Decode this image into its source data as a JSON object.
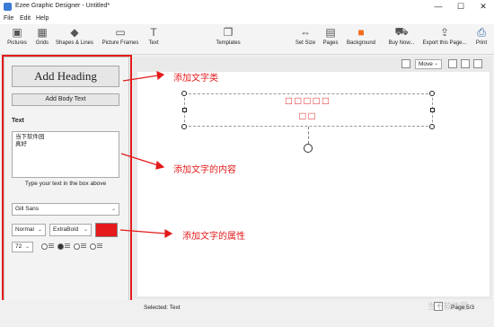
{
  "window": {
    "title": "Ezee Graphic Designer - Untitled*",
    "min_glyph": "—",
    "max_glyph": "☐",
    "close_glyph": "✕"
  },
  "menu": [
    "File",
    "Edit",
    "Help"
  ],
  "toolbar": [
    {
      "label": "Pictures",
      "icon": "pictures-icon",
      "glyph": "▣"
    },
    {
      "label": "Grids",
      "icon": "grids-icon",
      "glyph": "▦"
    },
    {
      "label": "Shapes & Lines",
      "icon": "shapes-icon",
      "glyph": "◆"
    },
    {
      "label": "Picture Frames",
      "icon": "picture-frames-icon",
      "glyph": "▭"
    },
    {
      "label": "Text",
      "icon": "text-icon",
      "glyph": "T"
    },
    {
      "label": "Templates",
      "icon": "templates-icon",
      "glyph": "❐"
    },
    {
      "label": "Set Size",
      "icon": "set-size-icon",
      "glyph": "⇔"
    },
    {
      "label": "Pages",
      "icon": "pages-icon",
      "glyph": "▤"
    },
    {
      "label": "Background",
      "icon": "background-icon",
      "glyph": "■"
    },
    {
      "label": "Buy Now...",
      "icon": "cart-icon",
      "glyph": "⛟"
    },
    {
      "label": "Export this Page...",
      "icon": "export-icon",
      "glyph": "⇪"
    },
    {
      "label": "Print",
      "icon": "print-icon",
      "glyph": "⎙"
    }
  ],
  "panel": {
    "add_heading": "Add Heading",
    "add_body": "Add Body Text",
    "text_label": "Text",
    "text_value": "当下软件园\n真好",
    "text_hint": "Type your text in the box above",
    "font": "Gill Sans",
    "style": "Normal",
    "weight": "ExtraBold",
    "size": "72",
    "color": "#e51a1a"
  },
  "canvas": {
    "move_mode": "Move",
    "heading_line1": "□□□□□",
    "heading_line2": "□□"
  },
  "annotations": {
    "a1": "添加文字类",
    "a2": "添加文字的内容",
    "a3": "添加文字的属性"
  },
  "status": {
    "selected": "Selected: Text",
    "page": "Page 5/3"
  },
  "watermark": "当下软件园"
}
